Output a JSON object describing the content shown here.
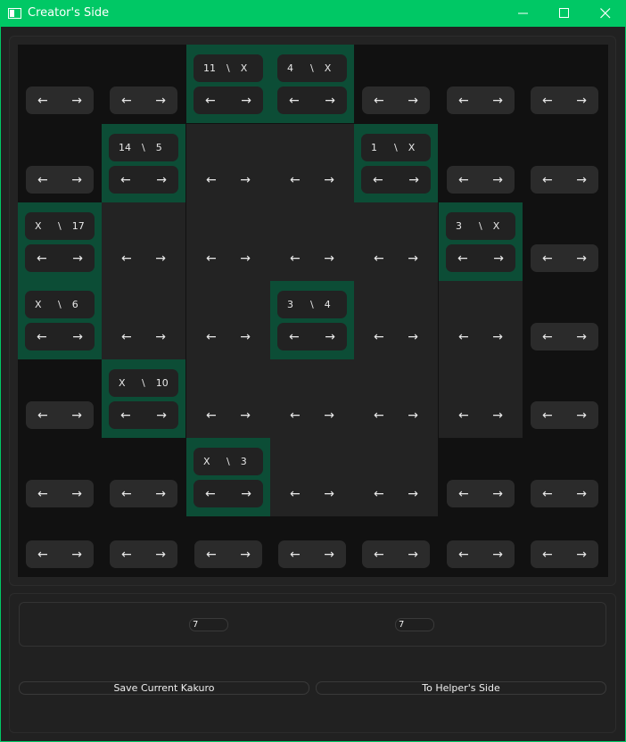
{
  "window": {
    "title": "Creator's Side",
    "accent": "#00c865"
  },
  "icons": {
    "app": "app-icon",
    "minimize": "minimize-icon",
    "maximize": "maximize-icon",
    "close": "close-icon"
  },
  "grid": {
    "rows": 7,
    "cols": 7,
    "colors": {
      "black": "#111111",
      "white": "#232323",
      "clue": "#0c4d36"
    },
    "cells": [
      [
        {
          "t": "b"
        },
        {
          "t": "b"
        },
        {
          "t": "c",
          "a": "11",
          "b": "X"
        },
        {
          "t": "c",
          "a": "4",
          "b": "X"
        },
        {
          "t": "b"
        },
        {
          "t": "b"
        },
        {
          "t": "b"
        }
      ],
      [
        {
          "t": "b"
        },
        {
          "t": "c",
          "a": "14",
          "b": "5"
        },
        {
          "t": "w"
        },
        {
          "t": "w"
        },
        {
          "t": "c",
          "a": "1",
          "b": "X"
        },
        {
          "t": "b"
        },
        {
          "t": "b"
        }
      ],
      [
        {
          "t": "c",
          "a": "X",
          "b": "17"
        },
        {
          "t": "w"
        },
        {
          "t": "w"
        },
        {
          "t": "w"
        },
        {
          "t": "w"
        },
        {
          "t": "c",
          "a": "3",
          "b": "X"
        },
        {
          "t": "b"
        }
      ],
      [
        {
          "t": "c",
          "a": "X",
          "b": "6"
        },
        {
          "t": "w"
        },
        {
          "t": "w"
        },
        {
          "t": "c",
          "a": "3",
          "b": "4"
        },
        {
          "t": "w"
        },
        {
          "t": "w"
        },
        {
          "t": "b"
        }
      ],
      [
        {
          "t": "b"
        },
        {
          "t": "c",
          "a": "X",
          "b": "10"
        },
        {
          "t": "w"
        },
        {
          "t": "w"
        },
        {
          "t": "w"
        },
        {
          "t": "w"
        },
        {
          "t": "b"
        }
      ],
      [
        {
          "t": "b"
        },
        {
          "t": "b"
        },
        {
          "t": "c",
          "a": "X",
          "b": "3"
        },
        {
          "t": "w"
        },
        {
          "t": "w"
        },
        {
          "t": "b"
        },
        {
          "t": "b"
        }
      ],
      [
        {
          "t": "b"
        },
        {
          "t": "b"
        },
        {
          "t": "b"
        },
        {
          "t": "b"
        },
        {
          "t": "b"
        },
        {
          "t": "b"
        },
        {
          "t": "b"
        }
      ]
    ],
    "left_arrow": "←",
    "right_arrow": "→",
    "clue_separator": "\\"
  },
  "controls": {
    "rows_value": "7",
    "cols_value": "7",
    "save_label": "Save Current Kakuro",
    "helper_label": "To Helper's Side"
  }
}
